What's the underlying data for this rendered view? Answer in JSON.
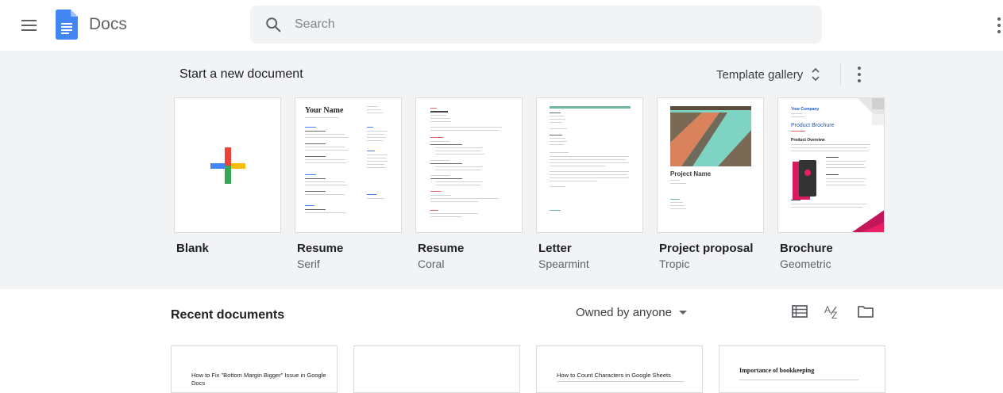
{
  "header": {
    "app_name": "Docs",
    "search_placeholder": "Search"
  },
  "templates": {
    "section_title": "Start a new document",
    "gallery_label": "Template gallery",
    "items": [
      {
        "name": "Blank",
        "sub": ""
      },
      {
        "name": "Resume",
        "sub": "Serif",
        "thumb_title": "Your Name"
      },
      {
        "name": "Resume",
        "sub": "Coral"
      },
      {
        "name": "Letter",
        "sub": "Spearmint"
      },
      {
        "name": "Project proposal",
        "sub": "Tropic",
        "thumb_title": "Project Name"
      },
      {
        "name": "Brochure",
        "sub": "Geometric",
        "thumb_title": "Product Brochure",
        "thumb_company": "Your Company",
        "thumb_overview": "Product Overview"
      }
    ]
  },
  "recent": {
    "title": "Recent documents",
    "owner_filter": "Owned by anyone",
    "docs": [
      {
        "title": "How to Fix \"Bottom Margin Bigger\" Issue in Google Docs"
      },
      {
        "title": ""
      },
      {
        "title": "How to Count Characters in Google Sheets"
      },
      {
        "title": "Importance of bookkeeping"
      }
    ]
  },
  "colors": {
    "accent_blue": "#4285f4",
    "coral": "#e06666",
    "spearmint": "#6fb7a1",
    "tropic_teal": "#7fd3c3",
    "brochure_blue": "#1a5ad6"
  }
}
